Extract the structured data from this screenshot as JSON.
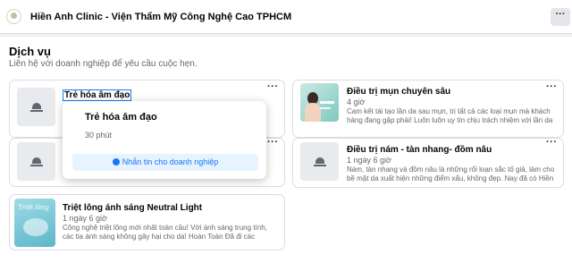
{
  "header": {
    "page_name": "Hiền Anh Clinic - Viện Thẩm Mỹ Công Nghệ Cao TPHCM",
    "more_label": "···"
  },
  "services": {
    "title": "Dịch vụ",
    "subtitle": "Liên hệ với doanh nghiệp để yêu cầu cuộc hẹn.",
    "items": [
      {
        "title": "Trẻ hóa âm đạo",
        "duration": "",
        "description": "",
        "icon": "bell-icon"
      },
      {
        "title": "Điều trị mụn chuyên sâu",
        "duration": "4 giờ",
        "description": "Cam kết tái tạo lần da sau mụn, trị tất cả các loại mụn mà khách hàng đang gặp phải! Luôn luôn uy tín chịu trách nhiệm với lần da của",
        "image": "woman-portrait"
      },
      {
        "title": "",
        "duration": "",
        "description": "",
        "icon": "bell-icon"
      },
      {
        "title": "Điều trị nám - tàn nhang- đồm nâu",
        "duration": "1 ngày 6 giờ",
        "description": "Nám, tàn nhang và đồm nâu là những rối loạn sắc tố giả, làm cho bề mặt da xuất hiện những điểm xấu, không đẹp. Nay đã có Hiền Anh s...",
        "icon": "bell-icon"
      },
      {
        "title": "Triệt lông ánh sáng Neutral Light",
        "duration": "1 ngày 6 giờ",
        "description": "Công nghệ triệt lông mới nhất toàn cầu! Với ánh sáng trung tính, các tia ánh sáng không gây hại cho da! Hoàn Toàn Đã đi các nang lông...",
        "image": "laser-promo"
      }
    ],
    "menu_label": "···"
  },
  "popover": {
    "title": "Trẻ hóa âm đạo",
    "duration": "30 phút",
    "button_label": "Nhắn tin cho doanh nghiệp"
  },
  "thumb_texts": {
    "laser_caption": "Triệt lông"
  },
  "colors": {
    "accent": "#1877f2",
    "background": "#f0f2f5",
    "muted_text": "#65676b"
  }
}
